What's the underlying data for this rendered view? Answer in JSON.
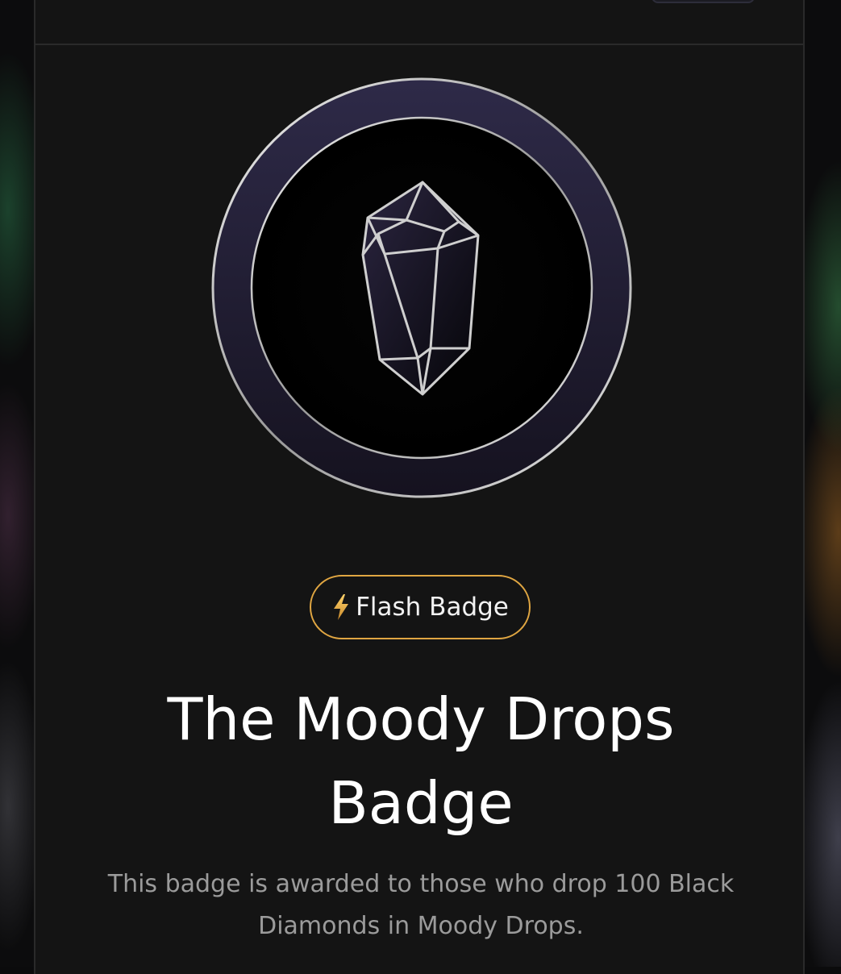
{
  "badge": {
    "tag_label": "Flash Badge",
    "tag_icon": "lightning-bolt-icon",
    "title": "The Moody Drops Badge",
    "description": "This badge is awarded to those who drop 100 Black Diamonds in Moody Drops.",
    "emblem": "black-diamond-icon"
  },
  "colors": {
    "panel_background": "#141414",
    "tag_border": "#e0a642",
    "title_text": "#ffffff",
    "description_text": "#9b9b9b",
    "ring": "#2e2a44"
  }
}
